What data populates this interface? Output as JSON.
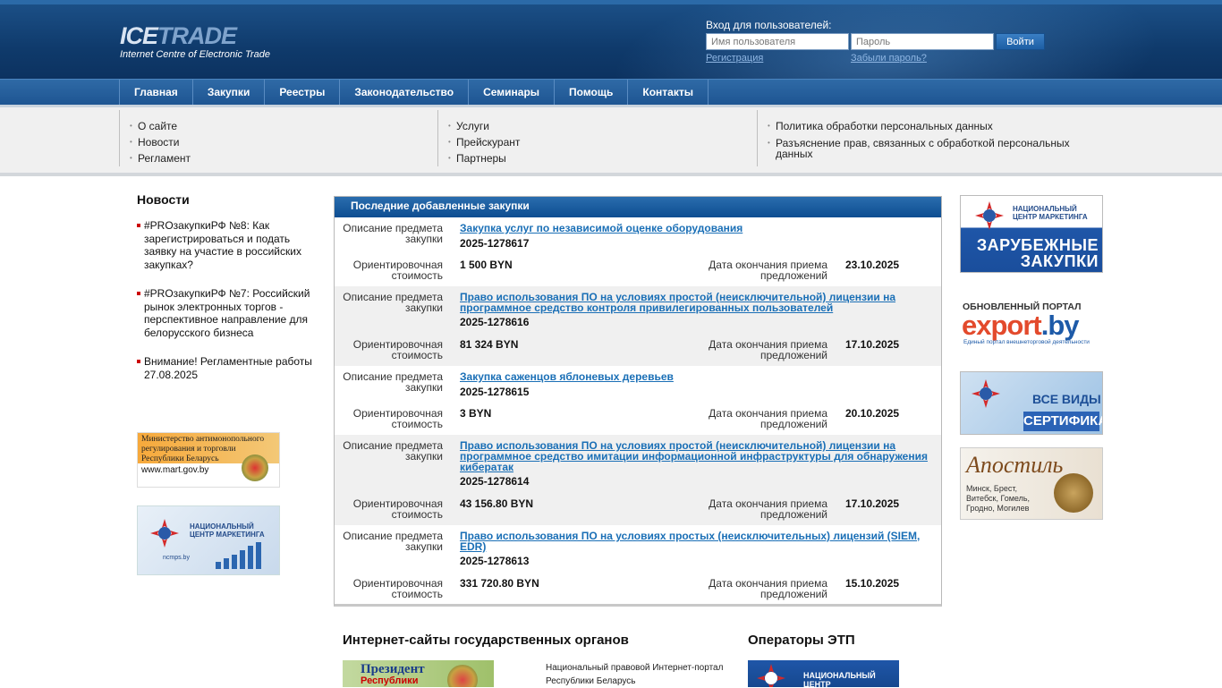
{
  "header": {
    "logo_main_a": "ICE",
    "logo_main_b": "TRADE",
    "logo_sub": "Internet Centre of Electronic Trade",
    "login_title": "Вход для пользователей:",
    "username_placeholder": "Имя пользователя",
    "password_placeholder": "Пароль",
    "login_button": "Войти",
    "register_link": "Регистрация",
    "forgot_link": "Забыли пароль?"
  },
  "nav": {
    "items": [
      "Главная",
      "Закупки",
      "Реестры",
      "Законодательство",
      "Семинары",
      "Помощь",
      "Контакты"
    ]
  },
  "subnav": {
    "col1": [
      "О сайте",
      "Новости",
      "Регламент"
    ],
    "col2": [
      "Услуги",
      "Прейскурант",
      "Партнеры"
    ],
    "col3": [
      "Политика обработки персональных данных",
      "Разъяснение прав, связанных с обработкой персональных данных"
    ]
  },
  "news": {
    "title": "Новости",
    "items": [
      "#PROзакупкиРФ №8: Как зарегистрироваться и подать заявку на участие в российских закупках?",
      "#PROзакупкиРФ №7: Российский рынок электронных торгов - перспективное направление для белорусского бизнеса",
      "Внимание! Регламентные работы 27.08.2025"
    ]
  },
  "left_banners": {
    "mart_lines": [
      "Министерство антимонопольного",
      "регулирования и торговли",
      "Республики Беларусь"
    ],
    "mart_url": "www.mart.gov.by",
    "ncm_lines": [
      "НАЦИОНАЛЬНЫЙ",
      "ЦЕНТР МАРКЕТИНГА"
    ],
    "ncm_url": "ncmps.by"
  },
  "purchases": {
    "title": "Последние добавленные закупки",
    "label_desc": "Описание предмета закупки",
    "label_cost": "Ориентировочная стоимость",
    "label_date": "Дата окончания приема предложений",
    "rows": [
      {
        "title": "Закупка услуг по независимой оценке оборудования",
        "number": "2025-1278617",
        "cost": "1 500 BYN",
        "date": "23.10.2025"
      },
      {
        "title": "Право использования ПО на условиях простой (неисключительной) лицензии на программное средство контроля привилегированных пользователей",
        "number": "2025-1278616",
        "cost": "81 324 BYN",
        "date": "17.10.2025"
      },
      {
        "title": "Закупка саженцов яблоневых деревьев",
        "number": "2025-1278615",
        "cost": "3 BYN",
        "date": "20.10.2025"
      },
      {
        "title": "Право использования ПО на условиях простой (неисключительной) лицензии на программное средство имитации информационной инфраструктуры для обнаружения кибератак",
        "number": "2025-1278614",
        "cost": "43 156.80 BYN",
        "date": "17.10.2025"
      },
      {
        "title": "Право использования ПО на условиях простых (неисключительных) лицензий (SIEM, EDR)",
        "number": "2025-1278613",
        "cost": "331 720.80 BYN",
        "date": "15.10.2025"
      }
    ]
  },
  "right_banners": {
    "rb1_small": "НАЦИОНАЛЬНЫЙ ЦЕНТР МАРКЕТИНГА",
    "rb1_big": "ЗАРУБЕЖНЫЕ ЗАКУПКИ",
    "rb2_top": "ОБНОВЛЕННЫЙ ПОРТАЛ",
    "rb2_brand_a": "export",
    "rb2_brand_b": ".by",
    "rb2_sub": "Единый портал внешнеторговой деятельности",
    "rb3_top": "ВСЕ ВИДЫ",
    "rb3_bottom": "СЕРТИФИКАТОВ",
    "rb4_title": "Апостиль",
    "rb4_cities": "Минск, Брест, Витебск, Гомель, Гродно, Могилев"
  },
  "bottom": {
    "gov_title": "Интернет-сайты государственных органов",
    "etp_title": "Операторы ЭТП",
    "president_line1": "Президент",
    "president_line2": "Республики",
    "pravo_text": "Национальный правовой Интернет-портал Республики Беларусь",
    "ncm_text": "НАЦИОНАЛЬНЫЙ ЦЕНТР МАРКЕТИНГА"
  },
  "colors": {
    "header": "#0f3a6b",
    "nav": "#1e5592",
    "link": "#1a6fb6"
  }
}
